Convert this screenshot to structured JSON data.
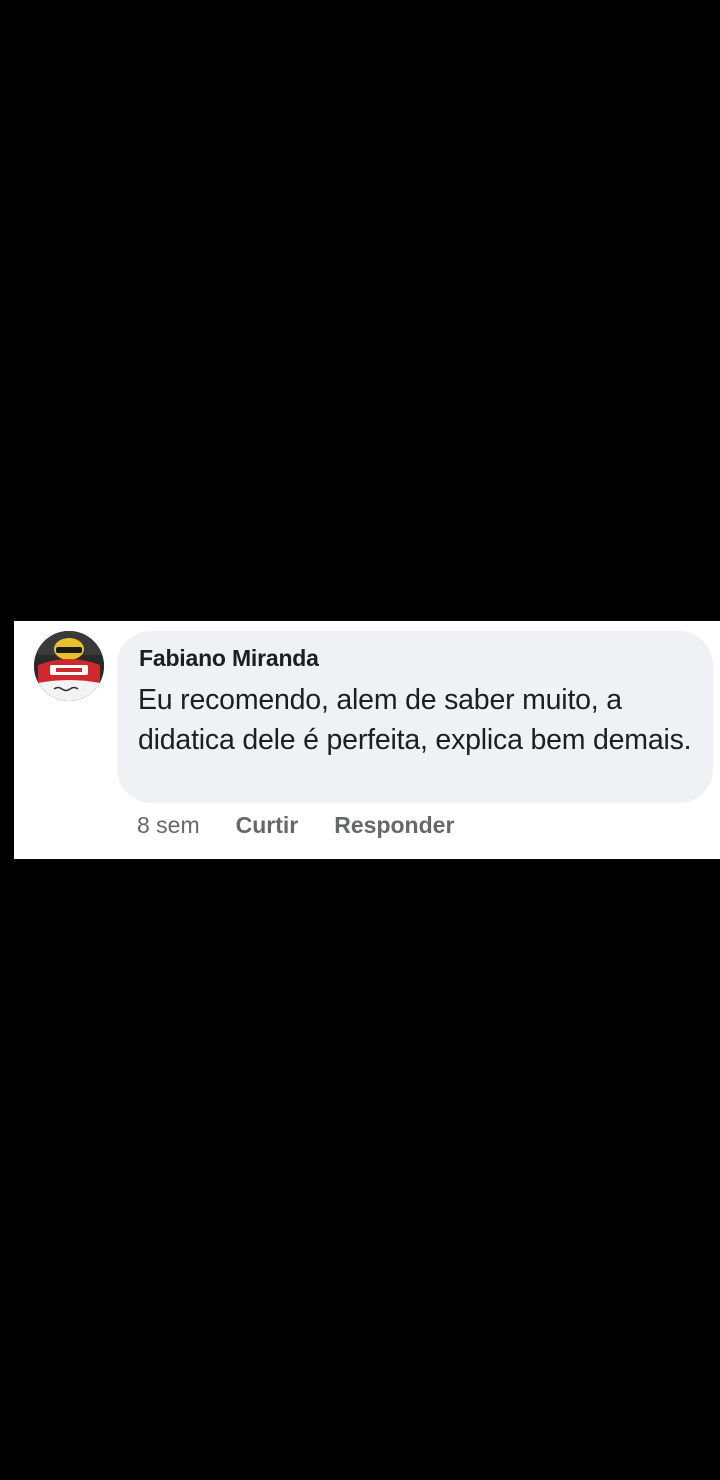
{
  "comment": {
    "author": "Fabiano Miranda",
    "text": "Eu recomendo, alem de saber muito, a didatica dele é perfeita, explica bem demais.",
    "timestamp": "8 sem",
    "like_label": "Curtir",
    "reply_label": "Responder"
  },
  "colors": {
    "background": "#000000",
    "card": "#ffffff",
    "bubble": "#eff1f4",
    "author_text": "#1c1e21",
    "meta_text": "#65676b",
    "avatar_accent": "#d0262e"
  },
  "icons": {
    "avatar": "profile-photo-avatar"
  }
}
